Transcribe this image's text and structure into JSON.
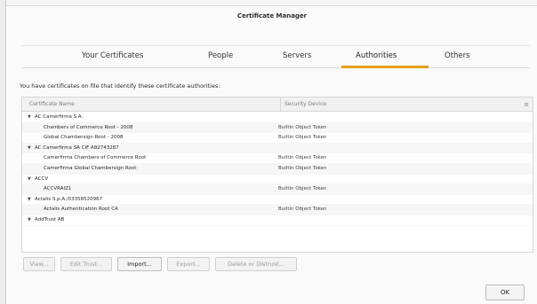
{
  "window": {
    "title": "Certificate Manager"
  },
  "tabs": [
    {
      "label": "Your Certificates"
    },
    {
      "label": "People"
    },
    {
      "label": "Servers"
    },
    {
      "label": "Authorities",
      "active": true
    },
    {
      "label": "Others"
    }
  ],
  "intro_text": "You have certificates on file that identify these certificate authorities:",
  "table": {
    "columns": [
      "Certificate Name",
      "Security Device"
    ],
    "rows": [
      {
        "type": "group",
        "name": "AC Camerfirma S.A.",
        "device": ""
      },
      {
        "type": "cert",
        "name": "Chambers of Commerce Root - 2008",
        "device": "Builtin Object Token"
      },
      {
        "type": "cert",
        "name": "Global Chambersign Root - 2008",
        "device": "Builtin Object Token"
      },
      {
        "type": "group",
        "name": "AC Camerfirma SA CIF A82743287",
        "device": ""
      },
      {
        "type": "cert",
        "name": "Camerfirma Chambers of Commerce Root",
        "device": "Builtin Object Token"
      },
      {
        "type": "cert",
        "name": "Camerfirma Global Chambersign Root",
        "device": "Builtin Object Token"
      },
      {
        "type": "group",
        "name": "ACCV",
        "device": ""
      },
      {
        "type": "cert",
        "name": "ACCVRAIZ1",
        "device": "Builtin Object Token"
      },
      {
        "type": "group",
        "name": "Actalis S.p.A./03358520967",
        "device": ""
      },
      {
        "type": "cert",
        "name": "Actalis Authentication Root CA",
        "device": "Builtin Object Token"
      },
      {
        "type": "group",
        "name": "AddTrust AB",
        "device": ""
      }
    ]
  },
  "buttons": {
    "view": "View...",
    "edit_trust": "Edit Trust...",
    "import": "Import...",
    "export": "Export...",
    "delete": "Delete or Distrust...",
    "ok": "OK"
  }
}
